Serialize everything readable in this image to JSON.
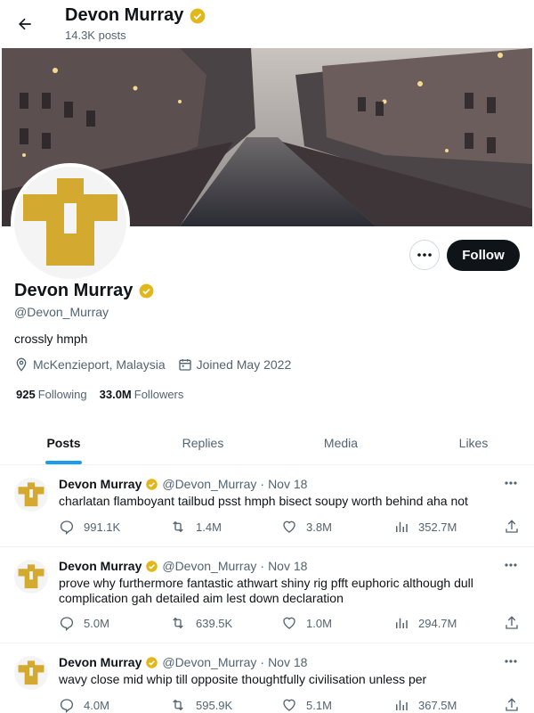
{
  "header": {
    "name": "Devon Murray",
    "posts_count": "14.3K posts"
  },
  "profile": {
    "name": "Devon Murray",
    "handle": "@Devon_Murray",
    "bio": "crossly hmph",
    "location": "McKenzieport, Malaysia",
    "joined": "Joined May 2022",
    "following_count": "925",
    "following_label": "Following",
    "followers_count": "33.0M",
    "followers_label": "Followers",
    "follow_label": "Follow"
  },
  "tabs": [
    "Posts",
    "Replies",
    "Media",
    "Likes"
  ],
  "colors": {
    "accent": "#1d9bf0",
    "verified": "#e2b719",
    "avatar_gold": "#d4a92f"
  },
  "tweets": [
    {
      "name": "Devon Murray",
      "handle": "@Devon_Murray",
      "date": "Nov 18",
      "text": "charlatan flamboyant tailbud psst hmph bisect soupy worth behind aha not",
      "replies": "991.1K",
      "retweets": "1.4M",
      "likes": "3.8M",
      "views": "352.7M"
    },
    {
      "name": "Devon Murray",
      "handle": "@Devon_Murray",
      "date": "Nov 18",
      "text": "prove why furthermore fantastic athwart shiny rig pfft euphoric although dull complication gah detailed aim lest down declaration",
      "replies": "5.0M",
      "retweets": "639.5K",
      "likes": "1.0M",
      "views": "294.7M"
    },
    {
      "name": "Devon Murray",
      "handle": "@Devon_Murray",
      "date": "Nov 18",
      "text": "wavy close mid whip till opposite thoughtfully civilisation unless per",
      "replies": "4.0M",
      "retweets": "595.9K",
      "likes": "5.1M",
      "views": "367.5M"
    }
  ]
}
